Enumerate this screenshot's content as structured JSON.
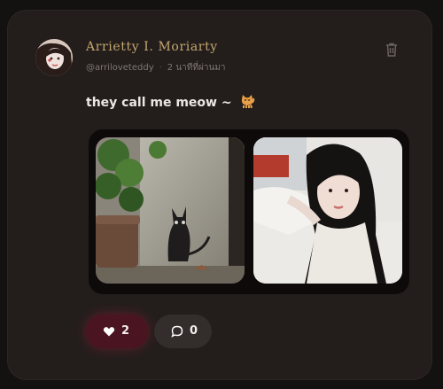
{
  "post": {
    "author_name": "Arrietty I. Moriarty",
    "username": "@arriloveteddy",
    "separator": "·",
    "time_ago": "2 นาทีที่ผ่านมา",
    "caption": "they call me meow ~",
    "caption_emoji": "cat-icon"
  },
  "photos": [
    {
      "name": "photo-cat-graffiti"
    },
    {
      "name": "photo-girl-portrait"
    }
  ],
  "actions": {
    "likes": "2",
    "comments": "0",
    "like_color": "#4a1420",
    "accent_color": "#c5a76e"
  }
}
